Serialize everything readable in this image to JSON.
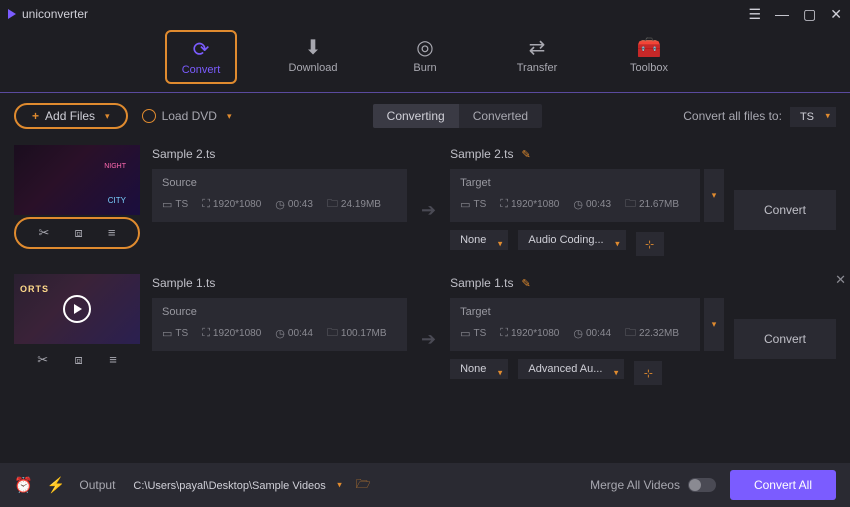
{
  "app": {
    "title": "uniconverter"
  },
  "tabs": {
    "convert": "Convert",
    "download": "Download",
    "burn": "Burn",
    "transfer": "Transfer",
    "toolbox": "Toolbox"
  },
  "toolbar": {
    "add_files": "Add Files",
    "load_dvd": "Load DVD",
    "converting": "Converting",
    "converted": "Converted",
    "convert_all_label": "Convert all files to:",
    "convert_all_format": "TS"
  },
  "files": [
    {
      "name": "Sample 2.ts",
      "source": {
        "head": "Source",
        "format": "TS",
        "res": "1920*1080",
        "dur": "00:43",
        "size": "24.19MB"
      },
      "target": {
        "head": "Target",
        "format": "TS",
        "res": "1920*1080",
        "dur": "00:43",
        "size": "21.67MB"
      },
      "subtitle": "None",
      "audio": "Audio Coding...",
      "convert": "Convert"
    },
    {
      "name": "Sample 1.ts",
      "source": {
        "head": "Source",
        "format": "TS",
        "res": "1920*1080",
        "dur": "00:44",
        "size": "100.17MB"
      },
      "target": {
        "head": "Target",
        "format": "TS",
        "res": "1920*1080",
        "dur": "00:44",
        "size": "22.32MB"
      },
      "subtitle": "None",
      "audio": "Advanced Au...",
      "convert": "Convert"
    }
  ],
  "bottom": {
    "output_label": "Output",
    "output_path": "C:\\Users\\payal\\Desktop\\Sample Videos",
    "merge_label": "Merge All Videos",
    "convert_all": "Convert All"
  }
}
